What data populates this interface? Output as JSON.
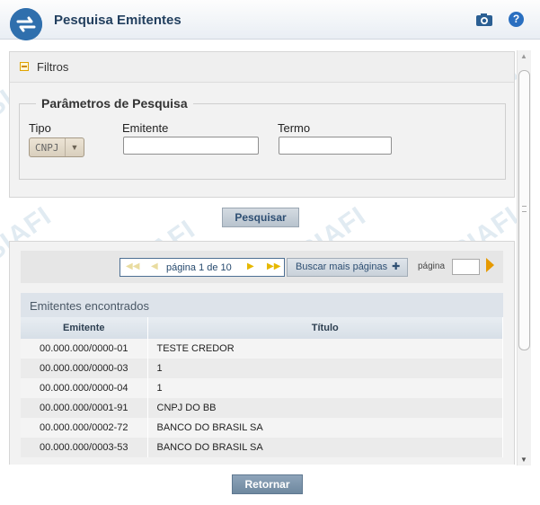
{
  "header": {
    "title": "Pesquisa Emitentes",
    "logo_icon": "siafi-logo-icon",
    "camera_icon": "camera-icon",
    "help_icon": "help-icon",
    "help_glyph": "?"
  },
  "watermark_text": "SIAFI",
  "filters": {
    "title": "Filtros",
    "fieldset_legend": "Parâmetros de Pesquisa",
    "tipo_label": "Tipo",
    "tipo_value": "CNPJ",
    "emitente_label": "Emitente",
    "emitente_value": "",
    "termo_label": "Termo",
    "termo_value": ""
  },
  "search_button": "Pesquisar",
  "paginator": {
    "page_text": "página 1 de 10",
    "more_button": "Buscar mais páginas",
    "page_label": "página",
    "page_input_value": ""
  },
  "results": {
    "title": "Emitentes encontrados",
    "columns": [
      "Emitente",
      "Título"
    ],
    "rows": [
      [
        "00.000.000/0000-01",
        "TESTE CREDOR"
      ],
      [
        "00.000.000/0000-03",
        "1"
      ],
      [
        "00.000.000/0000-04",
        "1"
      ],
      [
        "00.000.000/0001-91",
        "CNPJ DO BB"
      ],
      [
        "00.000.000/0002-72",
        "BANCO DO BRASIL SA"
      ],
      [
        "00.000.000/0003-53",
        "BANCO DO BRASIL SA"
      ]
    ]
  },
  "footer": {
    "return_button": "Retornar"
  },
  "colors": {
    "header_title": "#23405f",
    "accent_arrow": "#e69a00",
    "button_dark": "#6e889f"
  }
}
